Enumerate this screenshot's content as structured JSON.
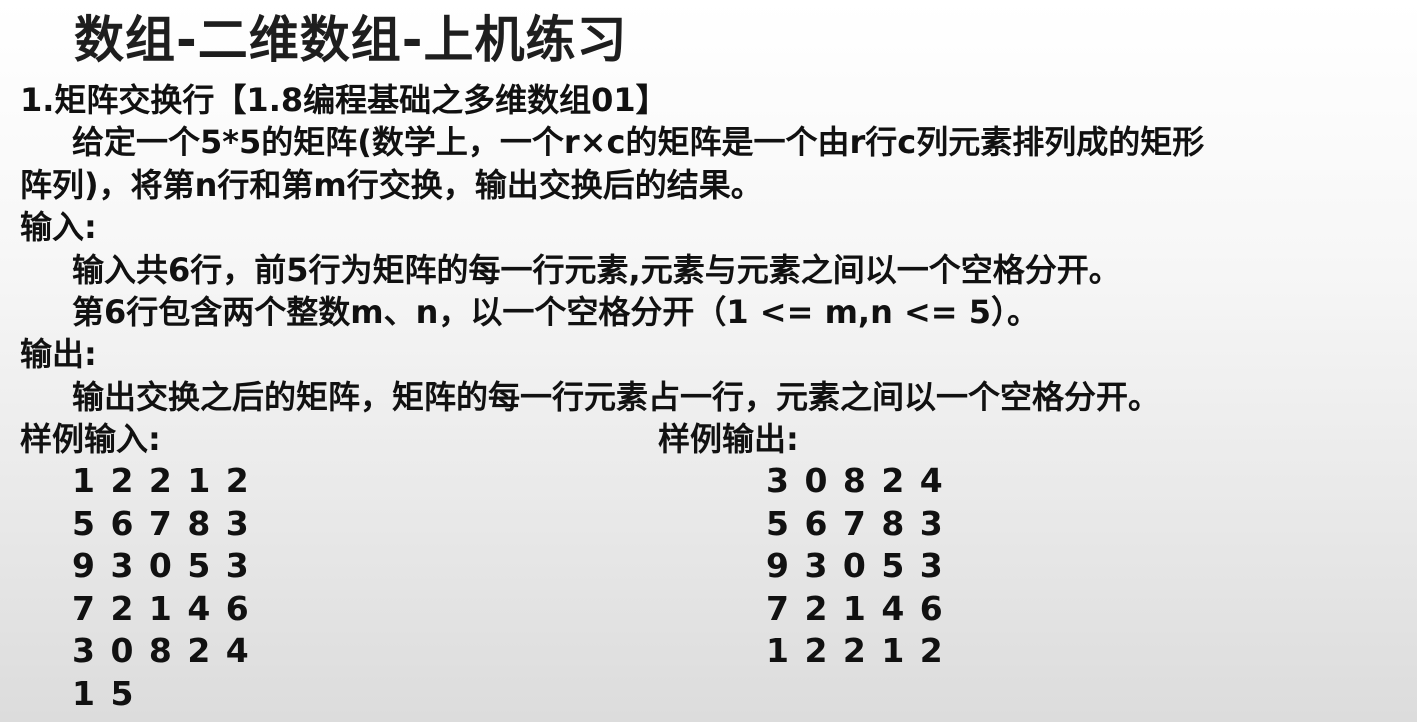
{
  "slide": {
    "title": "数组-二维数组-上机练习"
  },
  "problem": {
    "heading": "1.矩阵交换行【1.8编程基础之多维数组01】",
    "description_line1": "给定一个5*5的矩阵(数学上，一个r×c的矩阵是一个由r行c列元素排列成的矩形",
    "description_line2": "阵列)，将第n行和第m行交换，输出交换后的结果。",
    "input_label": "输入:",
    "input_line1": "输入共6行，前5行为矩阵的每一行元素,元素与元素之间以一个空格分开。",
    "input_line2": "第6行包含两个整数m、n，以一个空格分开（1 <= m,n <= 5）。",
    "output_label": "输出:",
    "output_line1": "输出交换之后的矩阵，矩阵的每一行元素占一行，元素之间以一个空格分开。",
    "sample_input_label": "样例输入:",
    "sample_output_label": "样例输出:",
    "sample_input": [
      "1 2 2 1 2",
      "5 6 7 8 3",
      "9 3 0 5 3",
      "7 2 1 4 6",
      "3 0 8 2 4",
      "1 5"
    ],
    "sample_output": [
      "3 0 8 2 4",
      "5 6 7 8 3",
      "9 3 0 5 3",
      "7 2 1 4 6",
      "1 2 2 1 2"
    ]
  }
}
